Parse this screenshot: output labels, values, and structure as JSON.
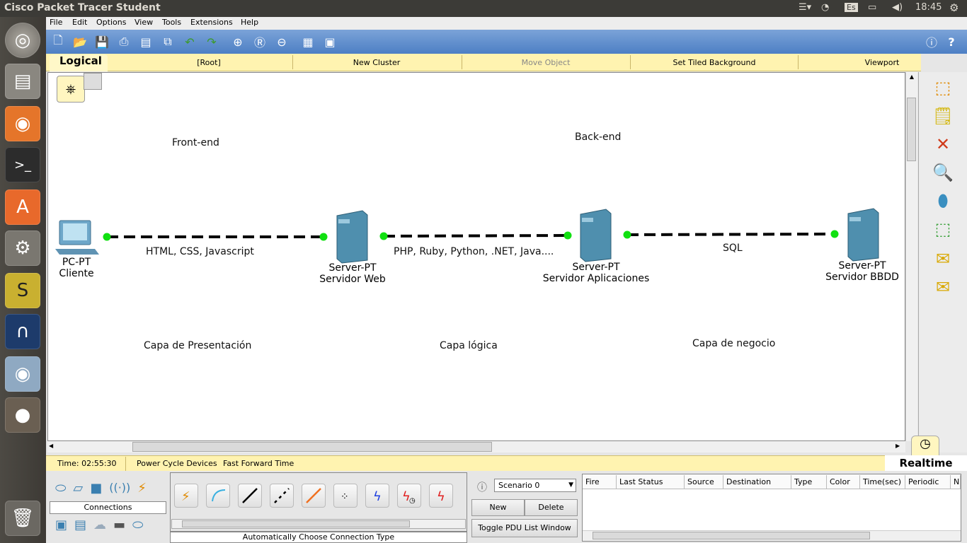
{
  "system": {
    "window_title": "Cisco Packet Tracer Student",
    "keyboard": "Es",
    "clock": "18:45"
  },
  "menu": [
    "File",
    "Edit",
    "Options",
    "View",
    "Tools",
    "Extensions",
    "Help"
  ],
  "workspace_bar": {
    "mode": "Logical",
    "items": [
      "[Root]",
      "New Cluster",
      "Move Object",
      "Set Tiled Background",
      "Viewport"
    ]
  },
  "canvas": {
    "notes": {
      "frontend": "Front-end",
      "backend": "Back-end",
      "proto1": "HTML, CSS, Javascript",
      "proto2": "PHP, Ruby, Python, .NET, Java....",
      "proto3": "SQL",
      "layer1": "Capa de Presentación",
      "layer2": "Capa lógica",
      "layer3": "Capa de negocio"
    },
    "devices": [
      {
        "type": "PC-PT",
        "name": "Cliente"
      },
      {
        "type": "Server-PT",
        "name": "Servidor Web"
      },
      {
        "type": "Server-PT",
        "name": "Servidor Aplicaciones"
      },
      {
        "type": "Server-PT",
        "name": "Servidor BBDD"
      }
    ]
  },
  "statusbar": {
    "time": "Time: 02:55:30",
    "power_cycle": "Power Cycle Devices",
    "fast_forward": "Fast Forward Time",
    "realtime": "Realtime"
  },
  "device_panel": {
    "category": "Connections",
    "connection_type": "Automatically Choose Connection Type"
  },
  "scenario": {
    "selected": "Scenario 0",
    "new": "New",
    "delete": "Delete",
    "toggle": "Toggle PDU List Window"
  },
  "pdu_table": {
    "columns": [
      "Fire",
      "Last Status",
      "Source",
      "Destination",
      "Type",
      "Color",
      "Time(sec)",
      "Periodic",
      "N"
    ]
  }
}
